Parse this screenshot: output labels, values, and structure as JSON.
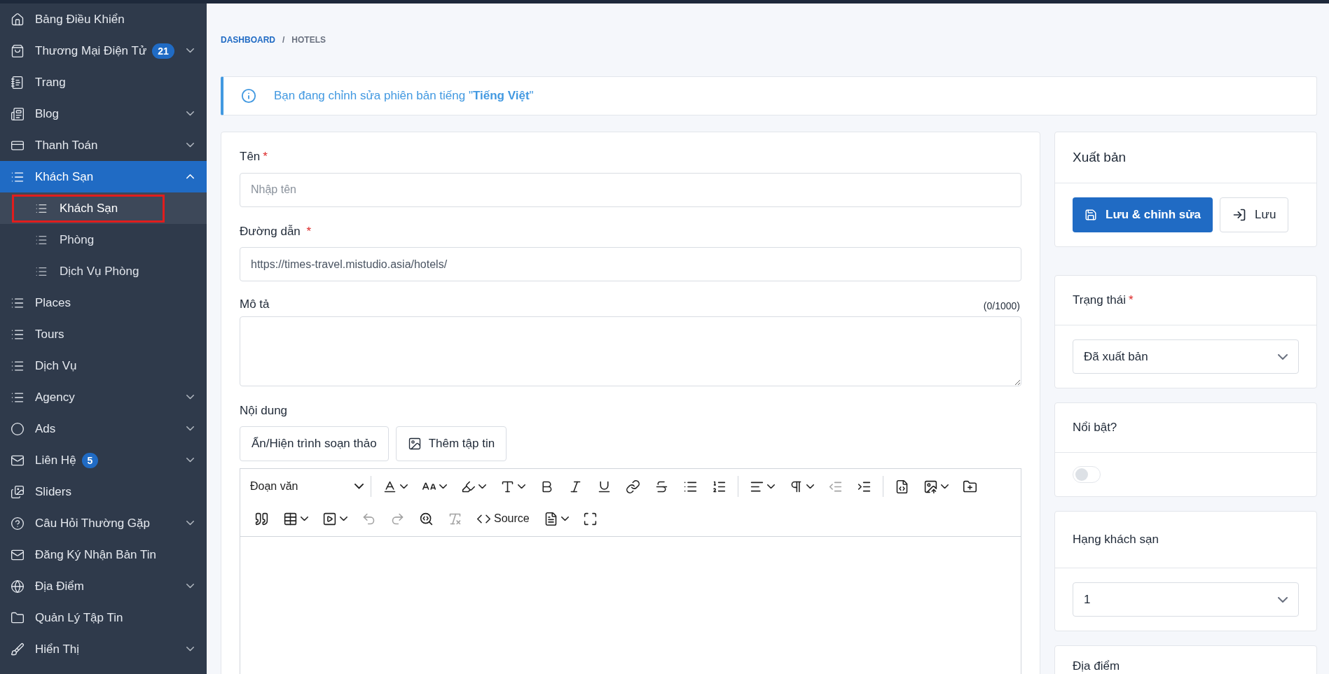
{
  "sidebar": {
    "items": [
      {
        "label": "Bảng Điều Khiển",
        "chevron": false,
        "selected": false
      },
      {
        "label": "Thương Mại Điện Tử",
        "badge": "21",
        "chevron": true,
        "expanded": false,
        "selected": false
      },
      {
        "label": "Trang",
        "chevron": false,
        "selected": false
      },
      {
        "label": "Blog",
        "chevron": true,
        "expanded": false,
        "selected": false
      },
      {
        "label": "Thanh Toán",
        "chevron": true,
        "expanded": false,
        "selected": false
      },
      {
        "label": "Khách Sạn",
        "chevron": true,
        "expanded": true,
        "selected": true,
        "children": [
          {
            "label": "Khách Sạn",
            "selected": true,
            "outlined": true
          },
          {
            "label": "Phòng",
            "selected": false,
            "outlined": false
          },
          {
            "label": "Dịch Vụ Phòng",
            "selected": false,
            "outlined": false
          }
        ]
      },
      {
        "label": "Places",
        "chevron": false,
        "selected": false
      },
      {
        "label": "Tours",
        "chevron": false,
        "selected": false
      },
      {
        "label": "Dịch Vụ",
        "chevron": false,
        "selected": false
      },
      {
        "label": "Agency",
        "chevron": true,
        "expanded": false,
        "selected": false
      },
      {
        "label": "Ads",
        "chevron": true,
        "expanded": false,
        "selected": false
      },
      {
        "label": "Liên Hệ",
        "badge": "5",
        "chevron": true,
        "expanded": false,
        "selected": false
      },
      {
        "label": "Sliders",
        "chevron": false,
        "selected": false
      },
      {
        "label": "Câu Hỏi Thường Gặp",
        "chevron": true,
        "expanded": false,
        "selected": false
      },
      {
        "label": "Đăng Ký Nhận Bản Tin",
        "chevron": false,
        "selected": false
      },
      {
        "label": "Địa Điểm",
        "chevron": true,
        "expanded": false,
        "selected": false
      },
      {
        "label": "Quản Lý Tập Tin",
        "chevron": false,
        "selected": false
      },
      {
        "label": "Hiển Thị",
        "chevron": true,
        "expanded": false,
        "selected": false
      }
    ]
  },
  "breadcrumb": [
    {
      "label": "DASHBOARD",
      "link": true
    },
    {
      "label": "HOTELS",
      "link": false
    }
  ],
  "breadcrumb_separator": "/",
  "alert": "Bạn đang chỉnh sửa phiên bản tiếng \"**Tiếng Việt**\"",
  "form": {
    "name": {
      "label": "Tên",
      "required_mark": "*",
      "placeholder": "Nhập tên"
    },
    "slug": {
      "label": "Đường dẫn",
      "required_mark": "*",
      "value": "https://times-travel.mistudio.asia/hotels/"
    },
    "description": {
      "label": "Mô tả",
      "counter": "(0/1000)"
    },
    "content": {
      "label": "Nội dung",
      "buttons": [
        "Ẩn/Hiện trình soạn thảo",
        "Thêm tập tin"
      ],
      "editor": {
        "format": "Đoạn văn",
        "toolbar": [
          [
            {
              "kind": "font-color",
              "dropdown": true,
              "disabled": false
            },
            {
              "kind": "font-size",
              "dropdown": true,
              "disabled": false
            },
            {
              "kind": "highlight",
              "dropdown": true,
              "disabled": false
            },
            {
              "kind": "font-family",
              "dropdown": true,
              "disabled": false
            },
            {
              "kind": "bold",
              "dropdown": false,
              "disabled": false
            },
            {
              "kind": "italic",
              "dropdown": false,
              "disabled": false
            },
            {
              "kind": "underline",
              "dropdown": false,
              "disabled": false
            },
            {
              "kind": "link",
              "dropdown": false,
              "disabled": false
            },
            {
              "kind": "strike",
              "dropdown": false,
              "disabled": false
            },
            {
              "kind": "bullets",
              "dropdown": false,
              "disabled": false
            },
            {
              "kind": "numbers",
              "dropdown": false,
              "disabled": false
            },
            {
              "kind": "sep"
            },
            {
              "kind": "align",
              "dropdown": true,
              "disabled": false
            },
            {
              "kind": "paragraph",
              "dropdown": true,
              "disabled": false
            },
            {
              "kind": "outdent",
              "dropdown": false,
              "disabled": true
            },
            {
              "kind": "indent",
              "dropdown": false,
              "disabled": false
            },
            {
              "kind": "sep"
            },
            {
              "kind": "html",
              "dropdown": false,
              "disabled": false
            },
            {
              "kind": "image",
              "dropdown": true,
              "disabled": false
            },
            {
              "kind": "folder",
              "dropdown": false,
              "disabled": false
            }
          ],
          [
            {
              "kind": "quote",
              "dropdown": false,
              "disabled": false
            },
            {
              "kind": "table",
              "dropdown": true,
              "disabled": false
            },
            {
              "kind": "media",
              "dropdown": true,
              "disabled": false
            },
            {
              "kind": "undo",
              "dropdown": false,
              "disabled": true
            },
            {
              "kind": "redo",
              "dropdown": false,
              "disabled": true
            },
            {
              "kind": "find",
              "dropdown": false,
              "disabled": false
            },
            {
              "kind": "clear",
              "dropdown": false,
              "disabled": true
            },
            {
              "kind": "source",
              "label": "Source",
              "dropdown": false,
              "disabled": false
            },
            {
              "kind": "template",
              "dropdown": true,
              "disabled": false
            },
            {
              "kind": "fullscreen",
              "dropdown": false,
              "disabled": false
            }
          ]
        ]
      }
    }
  },
  "publish": {
    "title": "Xuất bản",
    "buttons": [
      {
        "label": "Lưu & chỉnh sửa",
        "primary": true
      },
      {
        "label": "Lưu",
        "primary": false
      }
    ]
  },
  "status": {
    "title": "Trạng thái",
    "required_mark": "*",
    "value": "Đã xuất bản"
  },
  "featured": {
    "title": "Nổi bật?",
    "on": false
  },
  "rank": {
    "title": "Hạng khách sạn",
    "value": "1"
  },
  "location": {
    "title": "Địa điểm"
  }
}
